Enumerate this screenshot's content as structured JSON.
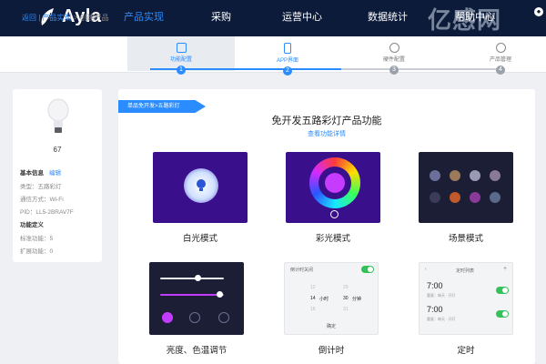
{
  "nav": {
    "logo": "Ayla",
    "items": [
      "产品实现",
      "采购",
      "运营中心",
      "数据统计",
      "帮助中心"
    ],
    "active_color": "#2a8cff"
  },
  "watermark": "亿感网",
  "breadcrumb": {
    "back": "返回",
    "section": "产品实现",
    "current": "创建产品"
  },
  "steps": [
    {
      "label": "功能配置",
      "num": "1"
    },
    {
      "label": "APP界面",
      "num": "2"
    },
    {
      "label": "硬件配置",
      "num": "3"
    },
    {
      "label": "产品管理",
      "num": "4"
    }
  ],
  "device": {
    "id": "67",
    "basic_info": "基本信息",
    "edit": "编辑",
    "type": "类型：五路彩灯",
    "comm": "通信方式：Wi-Fi",
    "pid": "PID：LL5-2BRAV7F",
    "func_def": "功能定义",
    "std_func": "标准功能：5",
    "ext_func": "扩展功能：0"
  },
  "main": {
    "ribbon": "单品免开发>五路彩灯",
    "title": "免开发五路彩灯产品功能",
    "link": "查看功能详情"
  },
  "features": [
    {
      "caption": "白光模式",
      "icon": "white-light-icon"
    },
    {
      "caption": "彩光模式",
      "icon": "color-wheel-icon"
    },
    {
      "caption": "场景模式",
      "icon": "scene-grid-icon"
    },
    {
      "caption": "亮度、色温调节",
      "icon": "brightness-slider-icon"
    },
    {
      "caption": "倒计时",
      "icon": "countdown-icon"
    },
    {
      "caption": "定时",
      "icon": "schedule-icon"
    }
  ],
  "timer_screens": {
    "countdown_header": "倒计时关闭",
    "countdown_values": [
      "12",
      "14",
      "16",
      "29",
      "30",
      "31"
    ],
    "countdown_units": [
      "小时",
      "分钟"
    ],
    "countdown_confirm": "确定",
    "schedule_header": "定时列表",
    "schedule_items": [
      "7:00",
      "7:00"
    ],
    "schedule_note": "重复：每天 · 开灯"
  },
  "colors": {
    "nav_bg": "#0c1b3a",
    "accent": "#2a8cff",
    "purple": "#3a0f8c",
    "dark": "#1c1e36"
  }
}
